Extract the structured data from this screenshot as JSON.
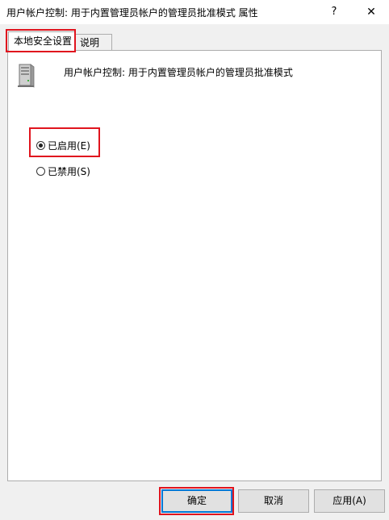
{
  "window": {
    "title": "用户帐户控制: 用于内置管理员帐户的管理员批准模式 属性",
    "help_label": "?",
    "close_label": "✕"
  },
  "tabs": [
    {
      "label": "本地安全设置",
      "selected": true
    },
    {
      "label": "说明",
      "selected": false
    }
  ],
  "policy": {
    "icon": "server-icon",
    "name": "用户帐户控制: 用于内置管理员帐户的管理员批准模式"
  },
  "options": {
    "enabled": {
      "label": "已启用(E)",
      "checked": true
    },
    "disabled": {
      "label": "已禁用(S)",
      "checked": false
    }
  },
  "buttons": {
    "ok": "确定",
    "cancel": "取消",
    "apply": "应用(A)"
  },
  "colors": {
    "highlight": "#e0141e",
    "default_button_border": "#0078d7",
    "panel_bg": "#ffffff",
    "window_bg": "#f0f0f0"
  }
}
